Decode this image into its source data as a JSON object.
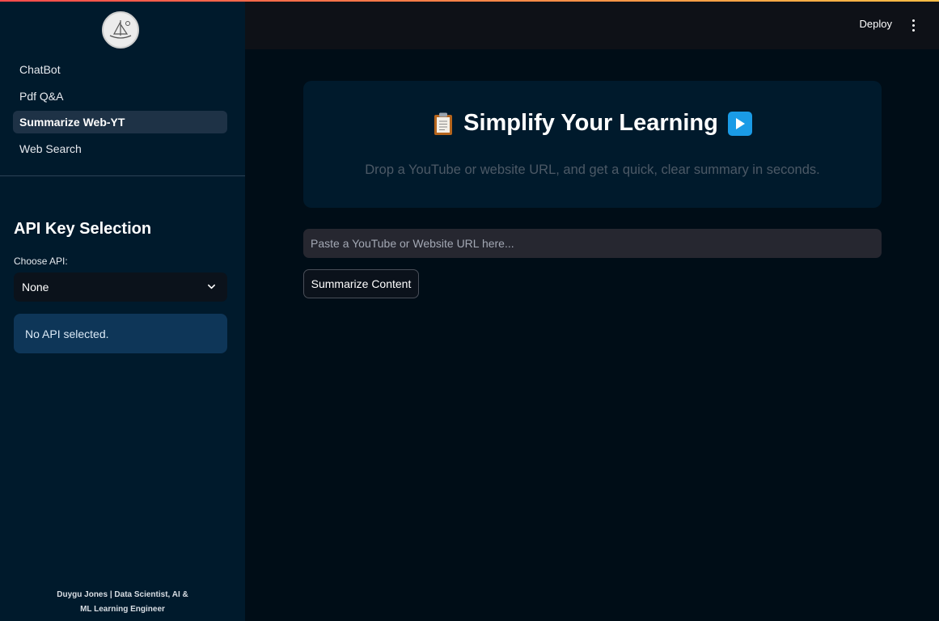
{
  "header": {
    "deploy_label": "Deploy"
  },
  "sidebar": {
    "nav_items": [
      {
        "label": "ChatBot"
      },
      {
        "label": "Pdf Q&A"
      },
      {
        "label": "Summarize Web-YT"
      },
      {
        "label": "Web Search"
      }
    ],
    "active_item": "Summarize Web-YT",
    "api_section": {
      "title": "API Key Selection",
      "choose_label": "Choose API:",
      "selected_value": "None",
      "info_message": "No API selected."
    },
    "footer": {
      "line1": "Duygu Jones | Data Scientist, AI &",
      "line2": "ML Learning Engineer"
    }
  },
  "main": {
    "hero": {
      "title": "Simplify Your Learning",
      "subtitle": "Drop a YouTube or website URL, and get a quick, clear summary in seconds.",
      "left_icon": "clipboard-icon",
      "right_icon": "play-icon"
    },
    "url_input": {
      "value": "",
      "placeholder": "Paste a YouTube or Website URL here..."
    },
    "submit_button_label": "Summarize Content"
  },
  "colors": {
    "sidebar_bg": "#001a2c",
    "main_bg": "#000d17",
    "header_bg": "#0e1117",
    "info_bg": "#0e3658",
    "input_bg": "#262730",
    "play_icon_blue": "#1a9be6"
  }
}
